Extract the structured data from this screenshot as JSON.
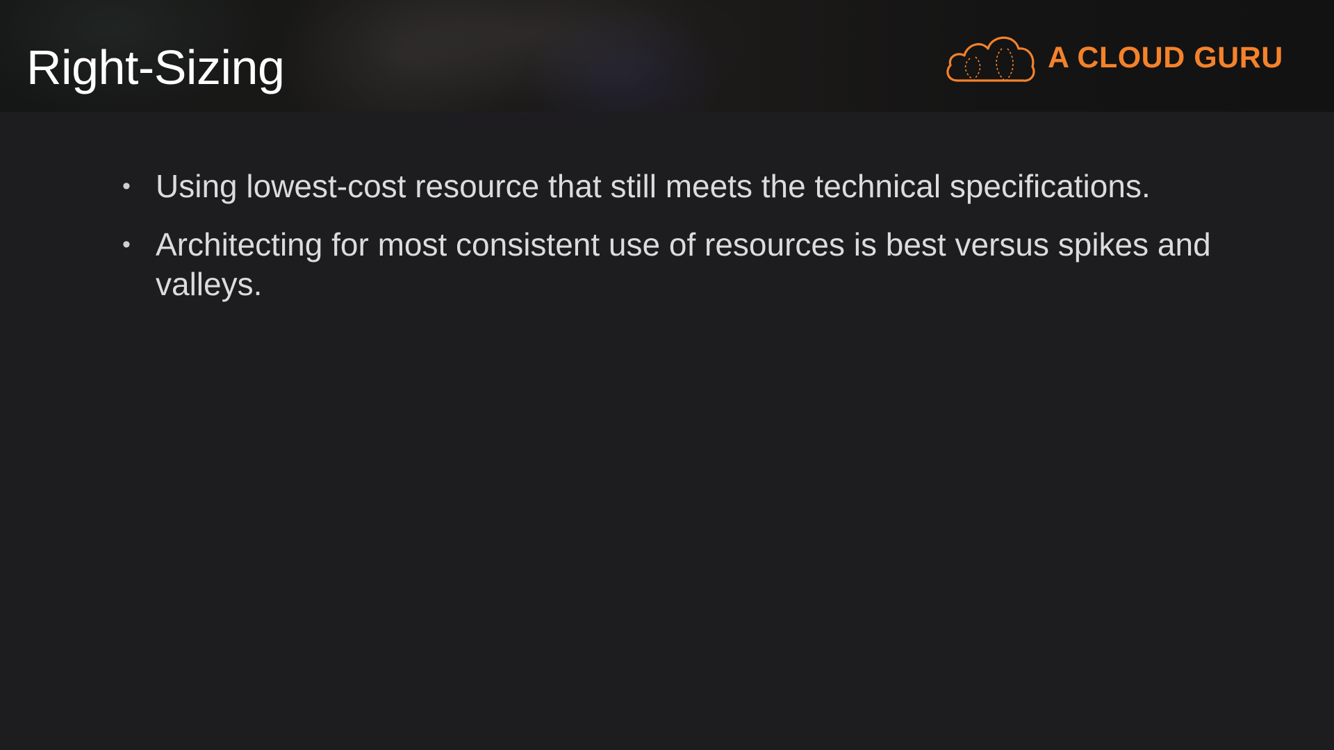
{
  "slide": {
    "title": "Right-Sizing",
    "bullets": [
      {
        "marker": "•",
        "text": "Using lowest-cost resource that still meets the technical specifications."
      },
      {
        "marker": "•",
        "text": "Architecting for most consistent use of resources is best versus spikes and valleys."
      }
    ]
  },
  "brand": {
    "name": "A CLOUD GURU",
    "logo_icon": "cloud-logo-icon",
    "accent_color": "#f4822b"
  },
  "colors": {
    "background": "#1d1c1f",
    "title": "#ffffff",
    "body_text": "#dcdcdc"
  }
}
